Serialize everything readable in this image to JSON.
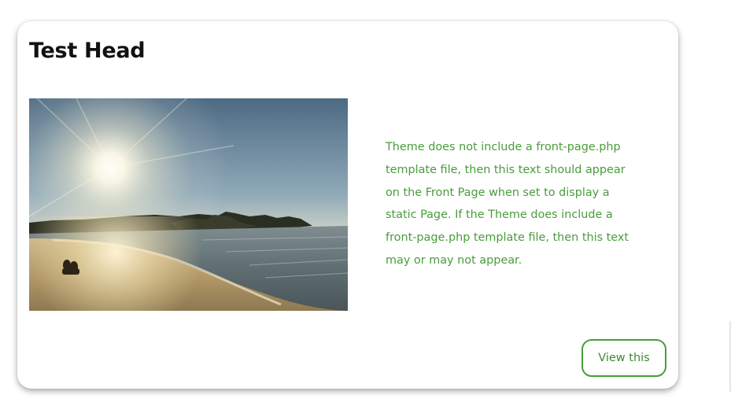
{
  "card": {
    "title": "Test Head",
    "image": {
      "description_icon": "beach-sunset-photo"
    },
    "text": "Theme does not include a front-page.php template file, then this text should appear on the Front Page when set to display a static Page. If the Theme does include a front-page.php template file, then this text may or may not appear.",
    "button_label": "View this"
  },
  "colors": {
    "accent": "#4a9c3c",
    "title": "#111111",
    "background": "#ffffff"
  }
}
